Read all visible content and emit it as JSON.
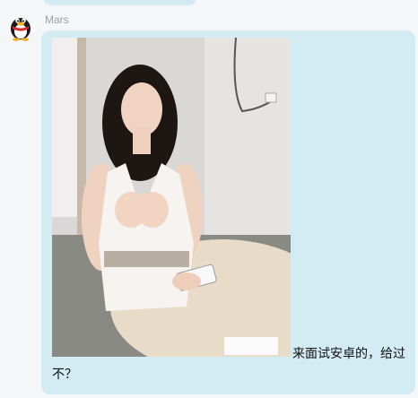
{
  "conversation": {
    "message": {
      "sender_name": "Mars",
      "avatar_icon": "penguin-avatar-icon",
      "image_alt": "photo",
      "text_line_1": "来面试安卓的，给过",
      "text_line_2": "不？"
    }
  },
  "colors": {
    "bubble": "#d3ebf3",
    "background": "#f5f6f7",
    "sender_text": "#9aa0a6"
  }
}
